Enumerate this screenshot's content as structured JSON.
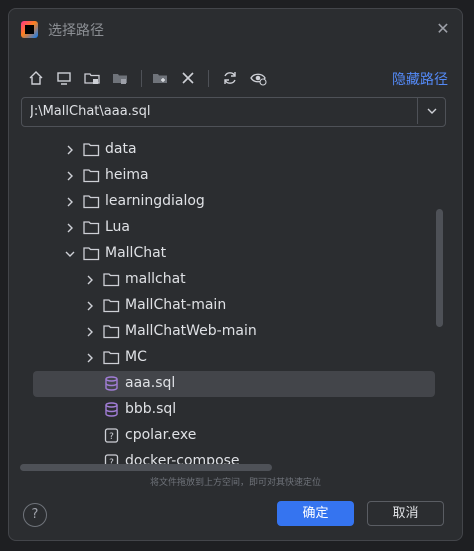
{
  "dialog": {
    "title": "选择路径",
    "close_glyph": "✕",
    "hide_path_label": "隐藏路径",
    "toolbar": [
      "home-icon",
      "desktop-icon",
      "project-folder-icon",
      "module-folder-icon",
      "new-folder-icon",
      "delete-icon",
      "refresh-icon",
      "show-hidden-icon"
    ]
  },
  "path": {
    "value": "J:\\MallChat\\aaa.sql"
  },
  "tree": [
    {
      "label": "data",
      "type": "folder",
      "expandable": true,
      "expanded": false,
      "depth": 0
    },
    {
      "label": "heima",
      "type": "folder",
      "expandable": true,
      "expanded": false,
      "depth": 0
    },
    {
      "label": "learningdialog",
      "type": "folder",
      "expandable": true,
      "expanded": false,
      "depth": 0
    },
    {
      "label": "Lua",
      "type": "folder",
      "expandable": true,
      "expanded": false,
      "depth": 0
    },
    {
      "label": "MallChat",
      "type": "folder",
      "expandable": true,
      "expanded": true,
      "depth": 0
    },
    {
      "label": "mallchat",
      "type": "folder",
      "expandable": true,
      "expanded": false,
      "depth": 1
    },
    {
      "label": "MallChat-main",
      "type": "folder",
      "expandable": true,
      "expanded": false,
      "depth": 1
    },
    {
      "label": "MallChatWeb-main",
      "type": "folder",
      "expandable": true,
      "expanded": false,
      "depth": 1
    },
    {
      "label": "MC",
      "type": "folder",
      "expandable": true,
      "expanded": false,
      "depth": 1
    },
    {
      "label": "aaa.sql",
      "type": "sql",
      "expandable": false,
      "selected": true,
      "depth": 1
    },
    {
      "label": "bbb.sql",
      "type": "sql",
      "expandable": false,
      "depth": 1
    },
    {
      "label": "cpolar.exe",
      "type": "unknown",
      "expandable": false,
      "depth": 1
    },
    {
      "label": "docker-compose",
      "type": "unknown",
      "expandable": false,
      "depth": 1
    }
  ],
  "hint": "将文件拖放到上方空间，即可对其快速定位",
  "buttons": {
    "help": "?",
    "ok": "确定",
    "cancel": "取消"
  },
  "colors": {
    "accent": "#3574f0",
    "link": "#548af7",
    "selection": "#43454a",
    "sql_icon": "#a17dd6"
  }
}
